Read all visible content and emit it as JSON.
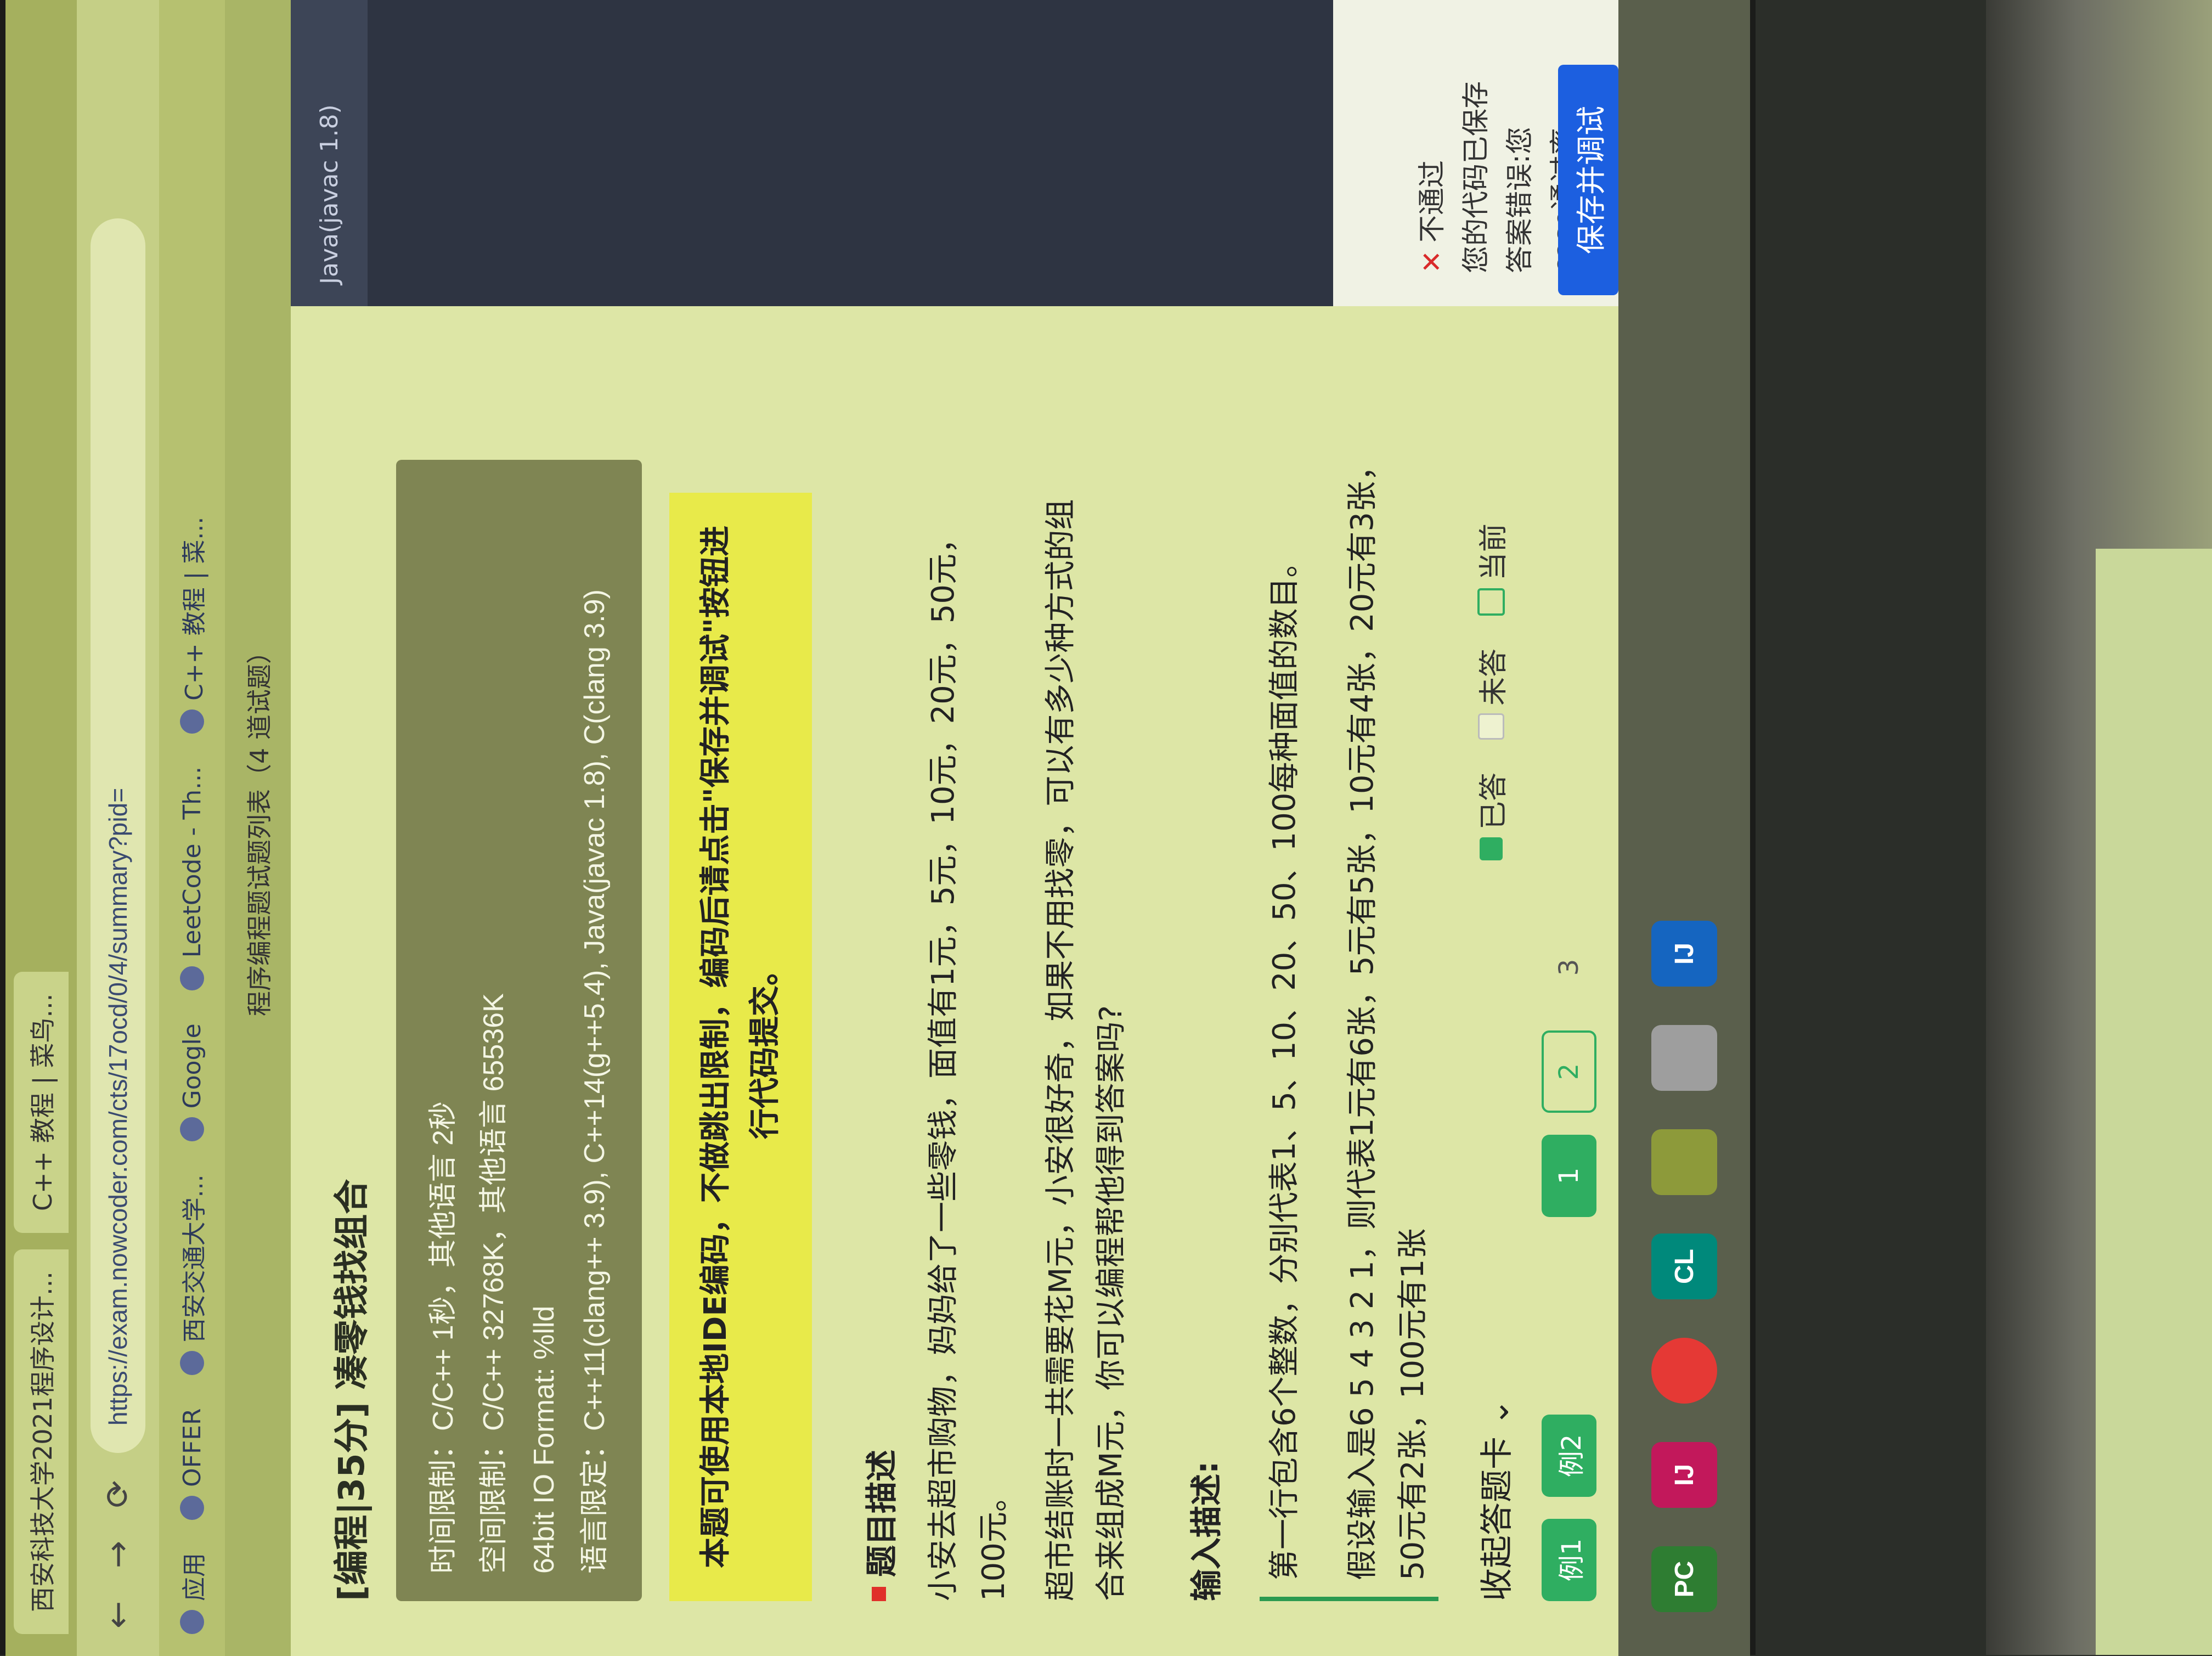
{
  "browser": {
    "tabs": [
      "西安科技大学2021程序设计...",
      "C++ 教程 | 菜鸟..."
    ],
    "url": "https://exam.nowcoder.com/cts/17ocd/0/4/summary?pid=",
    "bookmarks": [
      "应用",
      "OFFER",
      "西安交通大学...",
      "Google",
      "LeetCode - Th...",
      "C++ 教程 | 菜..."
    ],
    "subtitle": "程序编程题试题列表（4 道试题）"
  },
  "problem": {
    "title": "[编程|35分] 凑零钱找组合",
    "limits": [
      {
        "label": "时间限制：",
        "value": "C/C++ 1秒，其他语言 2秒"
      },
      {
        "label": "空间限制：",
        "value": "C/C++ 32768K，其他语言 65536K"
      },
      {
        "label": "",
        "value": "64bit IO Format: %lld"
      },
      {
        "label": "语言限定：",
        "value": "C++11(clang++ 3.9), C++14(g++5.4), Java(javac 1.8), C(clang 3.9)"
      }
    ],
    "notice": "本题可使用本地IDE编码，不做跳出限制，编码后请点击\"保存并调试\"按钮进行代码提交。",
    "desc_heading": "题目描述",
    "desc_p1": "小安去超市购物，妈妈给了一些零钱，面值有1元，5元，10元，20元，50元，100元。",
    "desc_p2": "超市结账时一共需要花M元，小安很好奇，如果不用找零，可以有多少种方式的组合来组成M元，你可以编程帮他得到答案吗?",
    "input_heading": "输入描述:",
    "input_p1": "第一行包含6个整数，分别代表1、5、10、20、50、100每种面值的数目。",
    "input_p2": "假设输入是6 5 4 3 2 1，则代表1元有6张，5元有5张，10元有4张，20元有3张，50元有2张，100元有1张"
  },
  "answer_card": {
    "collapse_label": "收起答题卡 ⌄",
    "legend": [
      "已答",
      "未答",
      "当前"
    ],
    "examples": [
      "例1",
      "例2"
    ],
    "pages": [
      "1",
      "2",
      "3"
    ]
  },
  "editor": {
    "language": "Java(javac 1.8)"
  },
  "result": {
    "status": "不通过",
    "line1": "您的代码已保存",
    "line2": "答案错误:您",
    "line3": "case通过率"
  },
  "save_button": "保存并调试",
  "taskbar": [
    "PC",
    "IJ",
    "CL",
    "IJ"
  ],
  "colors": {
    "accent_green": "#2fae61",
    "save_blue": "#1c5fe0",
    "notice_yellow": "#e8ea4a",
    "error_red": "#d92a2a"
  }
}
